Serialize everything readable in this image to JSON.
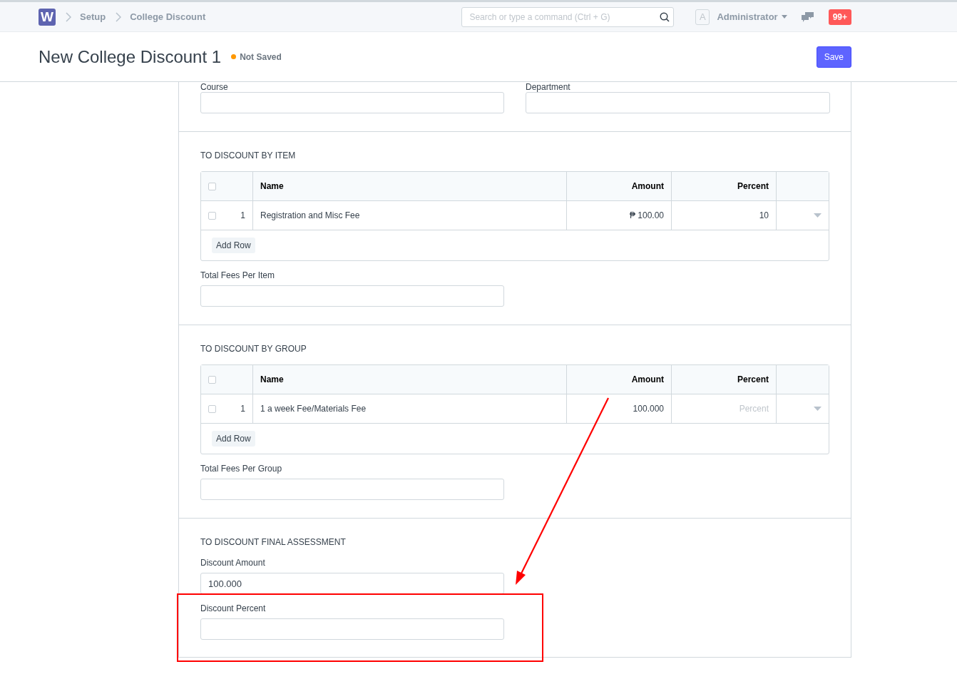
{
  "navbar": {
    "logo": "W",
    "breadcrumbs": [
      "Setup",
      "College Discount"
    ],
    "search": {
      "placeholder": "Search or type a command (Ctrl + G)"
    },
    "avatar": "A",
    "user": "Administrator",
    "notifications": "99+"
  },
  "page": {
    "title": "New College Discount 1",
    "status": "Not Saved",
    "primary_button": "Save"
  },
  "sections": [
    {
      "kind": "row",
      "fields": [
        {
          "label": "Course"
        },
        {
          "label": "Department"
        }
      ]
    },
    {
      "kind": "table",
      "heading": "TO DISCOUNT BY ITEM",
      "all_checked": false,
      "columns": [
        "Name",
        "Amount",
        "Percent"
      ],
      "rows": [
        {
          "index": "1",
          "checked": false,
          "cells": [
            {
              "value": "Registration and Misc Fee"
            },
            {
              "value": "₱ 100.00"
            },
            {
              "value": "10"
            }
          ]
        }
      ],
      "add_row": "Add Row",
      "fields": [
        {
          "label": "Total Fees Per Item"
        }
      ]
    },
    {
      "kind": "table",
      "heading": "TO DISCOUNT BY GROUP",
      "all_checked": false,
      "columns": [
        "Name",
        "Amount",
        "Percent"
      ],
      "rows": [
        {
          "index": "1",
          "checked": false,
          "cells": [
            {
              "value": "1 a week Fee/Materials Fee"
            },
            {
              "value": "100.000"
            },
            {
              "placeholder": "Percent"
            }
          ]
        }
      ],
      "add_row": "Add Row",
      "fields": [
        {
          "label": "Total Fees Per Group"
        }
      ]
    },
    {
      "kind": "stack",
      "heading": "TO DISCOUNT FINAL ASSESSMENT",
      "fields": [
        {
          "label": "Discount Amount",
          "value": "100.000"
        },
        {
          "label": "Discount Percent"
        }
      ]
    }
  ]
}
